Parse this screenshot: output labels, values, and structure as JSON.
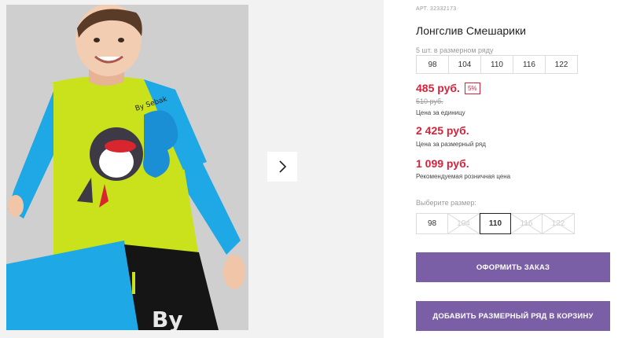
{
  "gallery": {
    "next_icon": "chevron-right-icon",
    "photo_print_text": "By Sebak"
  },
  "product": {
    "article": "АРТ. 32332173",
    "title": "Лонгслив Смешарики",
    "pack_label": "5 шт. в размерном ряду",
    "pack_sizes": [
      "98",
      "104",
      "110",
      "116",
      "122"
    ],
    "unit_price": "485 руб.",
    "discount": "5%",
    "old_price": "510 руб.",
    "unit_price_caption": "Цена за единицу",
    "pack_price": "2 425 руб.",
    "pack_price_caption": "Цена за размерный ряд",
    "retail_price": "1 099 руб.",
    "retail_price_caption": "Рекомендуемая розничная цена"
  },
  "size_selector": {
    "label": "Выберите размер:",
    "options": [
      {
        "label": "98",
        "state": "available"
      },
      {
        "label": "104",
        "state": "unavailable"
      },
      {
        "label": "110",
        "state": "selected"
      },
      {
        "label": "116",
        "state": "unavailable"
      },
      {
        "label": "122",
        "state": "unavailable"
      }
    ]
  },
  "actions": {
    "order_label": "ОФОРМИТЬ ЗАКАЗ",
    "add_pack_label": "ДОБАВИТЬ РАЗМЕРНЫЙ РЯД В КОРЗИНУ"
  },
  "colors": {
    "accent_button": "#7b5fa6",
    "price_red": "#d6223b"
  }
}
